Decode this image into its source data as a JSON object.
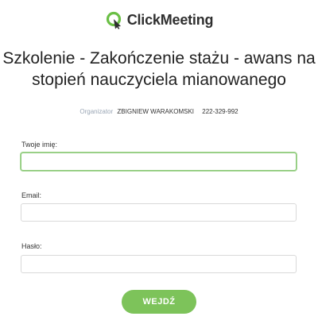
{
  "brand": {
    "name": "ClickMeeting",
    "icon": "clickmeeting-logo-icon",
    "accent_color": "#7dc35a"
  },
  "event": {
    "title": "Szkolenie - Zakończenie stażu - awans na stopień nauczyciela mianowanego"
  },
  "organizer": {
    "label": "Organizator",
    "name": "ZBIGNIEW WARAKOMSKI",
    "phone": "222-329-992"
  },
  "form": {
    "name_label": "Twoje imię:",
    "name_value": "",
    "email_label": "Email:",
    "email_value": "",
    "password_label": "Hasło:",
    "password_value": "",
    "submit_label": "WEJDŹ"
  }
}
